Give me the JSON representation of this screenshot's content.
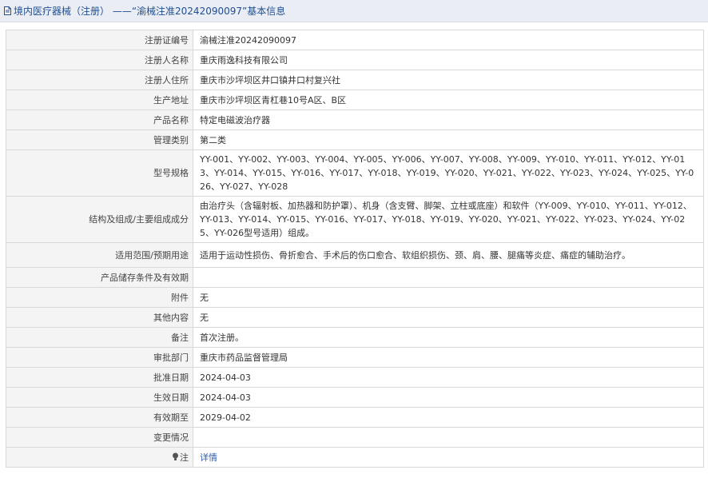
{
  "header": {
    "title": "境内医疗器械（注册） ——“渝械注准20242090097”基本信息"
  },
  "rows": [
    {
      "label": "注册证编号",
      "value": "渝械注准20242090097"
    },
    {
      "label": "注册人名称",
      "value": "重庆雨逸科技有限公司"
    },
    {
      "label": "注册人住所",
      "value": "重庆市沙坪坝区井口镇井口村复兴社"
    },
    {
      "label": "生产地址",
      "value": "重庆市沙坪坝区青杠巷10号A区、B区"
    },
    {
      "label": "产品名称",
      "value": "特定电磁波治疗器"
    },
    {
      "label": "管理类别",
      "value": "第二类"
    },
    {
      "label": "型号规格",
      "value": "YY-001、YY-002、YY-003、YY-004、YY-005、YY-006、YY-007、YY-008、YY-009、YY-010、YY-011、YY-012、YY-013、YY-014、YY-015、YY-016、YY-017、YY-018、YY-019、YY-020、YY-021、YY-022、YY-023、YY-024、YY-025、YY-026、YY-027、YY-028"
    },
    {
      "label": "结构及组成/主要组成成分",
      "value": "由治疗头（含辐射板、加热器和防护罩）、机身（含支臂、脚架、立柱或底座）和软件（YY-009、YY-010、YY-011、YY-012、YY-013、YY-014、YY-015、YY-016、YY-017、YY-018、YY-019、YY-020、YY-021、YY-022、YY-023、YY-024、YY-025、YY-026型号适用）组成。"
    },
    {
      "label": "适用范围/预期用途",
      "value": "适用于运动性损伤、骨折愈合、手术后的伤口愈合、软组织损伤、颈、肩、腰、腿痛等炎症、痛症的辅助治疗。"
    },
    {
      "label": "产品储存条件及有效期",
      "value": ""
    },
    {
      "label": "附件",
      "value": "无"
    },
    {
      "label": "其他内容",
      "value": "无"
    },
    {
      "label": "备注",
      "value": "首次注册。"
    },
    {
      "label": "审批部门",
      "value": "重庆市药品监督管理局"
    },
    {
      "label": "批准日期",
      "value": "2024-04-03"
    },
    {
      "label": "生效日期",
      "value": "2024-04-03"
    },
    {
      "label": "有效期至",
      "value": "2029-04-02"
    },
    {
      "label": "变更情况",
      "value": ""
    }
  ],
  "note": {
    "label": "注",
    "link_text": "详情"
  },
  "icons": {
    "header": "document-icon",
    "note": "lightbulb-icon"
  },
  "colors": {
    "title": "#1f4e92",
    "link": "#2a5db0"
  }
}
